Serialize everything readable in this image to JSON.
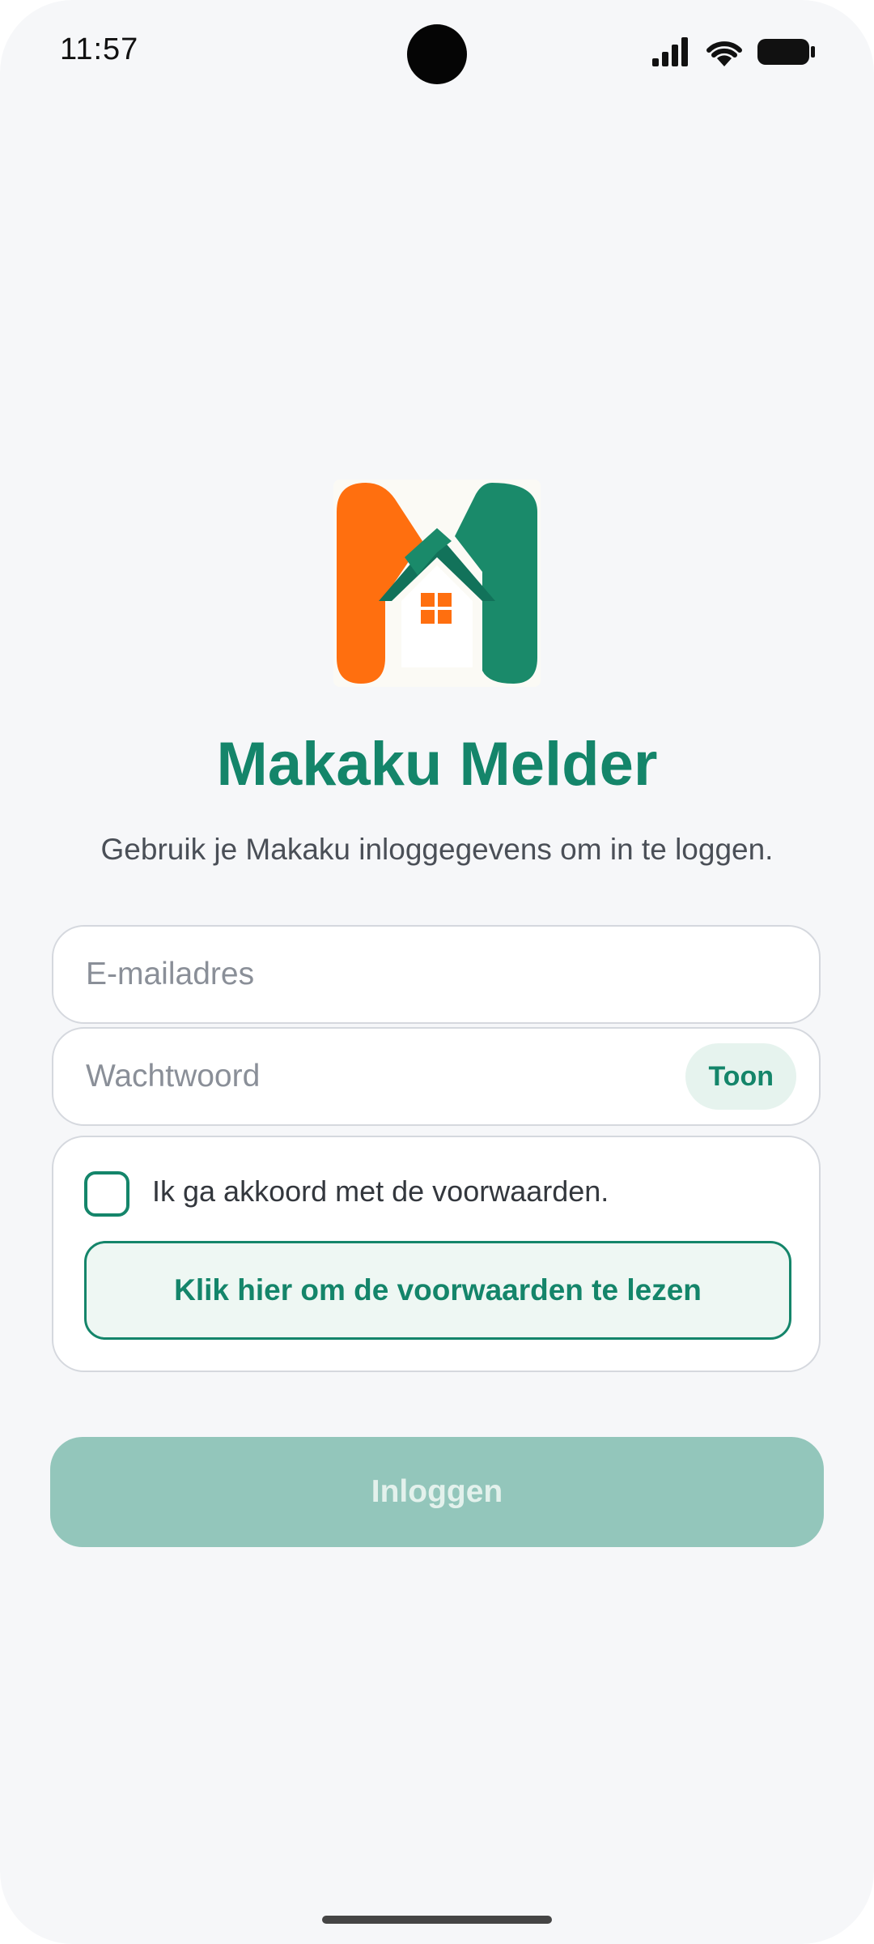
{
  "status_bar": {
    "time": "11:57",
    "icons": [
      "signal-icon",
      "wifi-icon",
      "battery-icon"
    ]
  },
  "brand": {
    "logo_icon": "makaku-house-logo",
    "title": "Makaku Melder",
    "subtitle": "Gebruik je Makaku inloggegevens om in te loggen."
  },
  "form": {
    "email_placeholder": "E-mailadres",
    "email_value": "",
    "password_placeholder": "Wachtwoord",
    "password_value": "",
    "show_password_label": "Toon",
    "terms_checkbox_label": "Ik ga akkoord met de voorwaarden.",
    "terms_checked": false,
    "terms_link_label": "Klik hier om de voorwaarden te lezen",
    "login_label": "Inloggen",
    "login_enabled": false
  },
  "colors": {
    "primary": "#14856a",
    "primary_disabled": "#93c6bb",
    "logo_orange": "#ff6f0f",
    "logo_green": "#1a8a6a",
    "background": "#f6f7f9"
  }
}
